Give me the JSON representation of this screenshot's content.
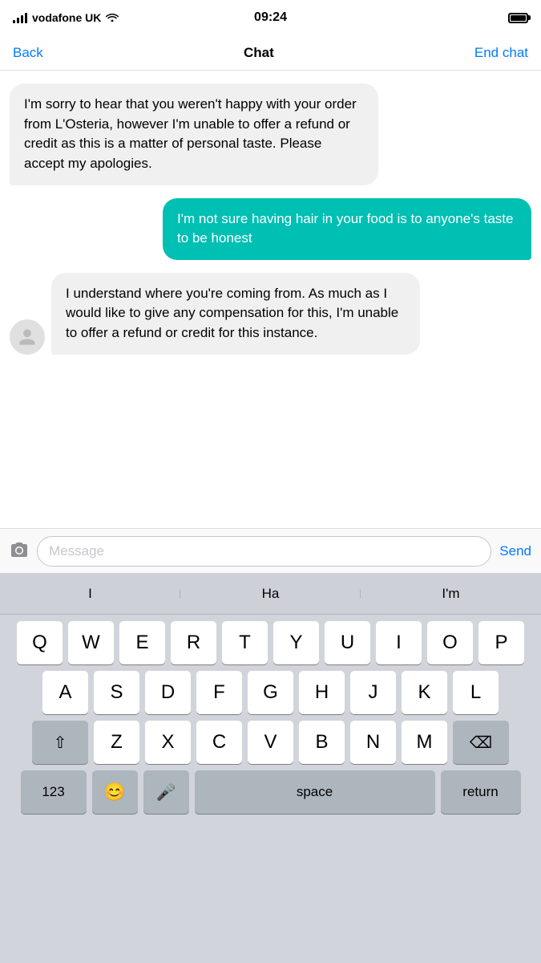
{
  "statusBar": {
    "carrier": "vodafone UK",
    "time": "09:24",
    "batteryFull": true
  },
  "navBar": {
    "backLabel": "Back",
    "title": "Chat",
    "endChatLabel": "End chat"
  },
  "messages": [
    {
      "id": "msg1",
      "type": "incoming",
      "text": "I'm sorry to hear that you weren't happy with your order from   L'Osteria, however I'm unable to offer a refund or credit as this is a matter of personal taste. Please accept my apologies.",
      "hasAvatar": false
    },
    {
      "id": "msg2",
      "type": "outgoing",
      "text": "I'm not sure having hair in your food is to anyone's taste to be honest",
      "hasAvatar": false
    },
    {
      "id": "msg3",
      "type": "incoming",
      "text": "I understand where you're coming from. As much as I would like to give any compensation for this,  I'm unable to offer a refund or credit for this instance.",
      "hasAvatar": true
    }
  ],
  "inputArea": {
    "placeholder": "Message",
    "sendLabel": "Send"
  },
  "keyboard": {
    "autocomplete": [
      "I",
      "Ha",
      "I'm"
    ],
    "rows": [
      [
        "Q",
        "W",
        "E",
        "R",
        "T",
        "Y",
        "U",
        "I",
        "O",
        "P"
      ],
      [
        "A",
        "S",
        "D",
        "F",
        "G",
        "H",
        "J",
        "K",
        "L"
      ],
      [
        "⇧",
        "Z",
        "X",
        "C",
        "V",
        "B",
        "N",
        "M",
        "⌫"
      ],
      [
        "123",
        "😊",
        "🎤",
        "space",
        "return"
      ]
    ]
  },
  "colors": {
    "outgoingBubble": "#00bfb3",
    "incomingBubble": "#f0f0f0",
    "accent": "#007aff",
    "keyboardBg": "#d1d5db",
    "keyBg": "#ffffff",
    "actionKeyBg": "#adb5bd"
  }
}
